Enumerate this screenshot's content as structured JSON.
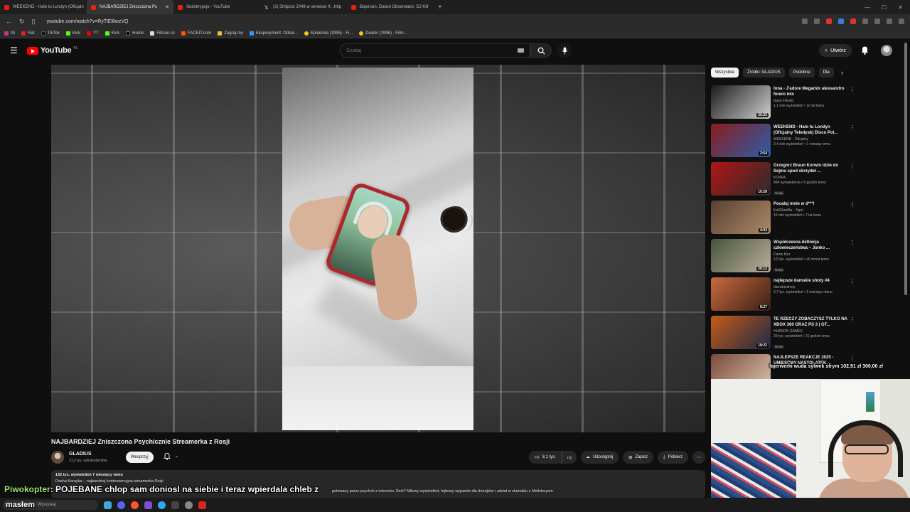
{
  "browser": {
    "tabs": [
      {
        "label": "WEEKEND - Halo tu Londyn (Oficjaln",
        "active": false,
        "icon": "youtube-icon"
      },
      {
        "label": "NAJBARDZIEJ Zniszczona Ps",
        "active": true,
        "icon": "youtube-icon"
      },
      {
        "label": "Subskrypcje - YouTube",
        "active": false,
        "icon": "youtube-icon"
      },
      {
        "label": "(3) Shitpost 2049 w serwisie X: „http",
        "active": false,
        "icon": "x-icon"
      },
      {
        "label": "Bajorson, Dawid Obserwator, DJ Kill",
        "active": false,
        "icon": "youtube-icon"
      }
    ],
    "url": "youtube.com/watch?v=RyTlEl8wzVQ",
    "bookmarks": [
      "IG",
      "Rat",
      "TikTok",
      "Kick",
      "YT",
      "Kick",
      "Home",
      "Filman.cc",
      "FACEIT.com",
      "Zagraj.my",
      "Eksperyment: Odsia...",
      "Epidemia (1995) - Fi...",
      "Dealer (1996) - Film..."
    ]
  },
  "header": {
    "logo_text": "YouTube",
    "logo_country": "PL",
    "search_placeholder": "Szukaj",
    "create_label": "Utwórz"
  },
  "video": {
    "title": "NAJBARDZIEJ Zniszczona Psychicznie Streamerka z Rosji",
    "channel_name": "GLADIUS",
    "channel_subs": "31,2 tys. subskrybentów",
    "support_label": "Wesprzyj",
    "likes": "3,1 tys.",
    "share_label": "Udostępnij",
    "save_label": "Zapisz",
    "download_label": "Pobierz",
    "desc_meta": "132 tys. wyświetleń  7 miesięcy temu",
    "desc_line1": "Dasha Karayka – najbardziej kontrowersyjna streamerka Rosji",
    "desc_line2": "pulowany przez psycholi z internetu. Dziś? Miliony wyświetleń, fejkowy wypadek dla donejtów i udział w skandalu z Mellstroyem."
  },
  "chips": [
    "Wszystkie",
    "Źródło: GLADIUS",
    "Podobne",
    "Dla"
  ],
  "recommendations": [
    {
      "title": "Inna - J'adore Megamix alessandro ferero mix",
      "channel": "Saša Frković",
      "stats": "1,1 mln wyświetleń • 10 lat temu",
      "badge": "",
      "duration": "20:25",
      "colors": [
        "#1b1b1b",
        "#cfcfcf"
      ]
    },
    {
      "title": "WEEKEND - Halo tu Londyn (Oficjalny Teledysk) Disco Pol...",
      "channel": "WEEKEND - Oficjalny",
      "stats": "2,4 mln wyświetleń • 1 miesiąc temu",
      "badge": "",
      "duration": "2:54",
      "colors": [
        "#8a1d1d",
        "#2a5da8"
      ]
    },
    {
      "title": "Grzegorz Braun Korwin idzie do Sejmu spod skrzydeł ...",
      "channel": "KONFA",
      "stats": "484 wyświetlenia • 5 godzin temu",
      "badge": "Nowy",
      "duration": "10:28",
      "colors": [
        "#b11616",
        "#2b2b2b"
      ]
    },
    {
      "title": "Pocałuj mnie w d***!",
      "channel": "KaRRamBa - Topic",
      "stats": "10 mln wyświetleń • 7 lat temu",
      "badge": "",
      "duration": "4:03",
      "colors": [
        "#5a4030",
        "#aa8a6a"
      ]
    },
    {
      "title": "Współczesna definicja człowieczeństwa – Junko ...",
      "channel": "Dama Kier",
      "stats": "1,5 tys. wyświetleń • 40 minut temu",
      "badge": "Nowy",
      "duration": "26:12",
      "colors": [
        "#44553a",
        "#bcae9a"
      ]
    },
    {
      "title": "najlepsze damskie shoty #4",
      "channel": "damskieshoty",
      "stats": "2,7 tys. wyświetleń • 2 miesiące temu",
      "badge": "",
      "duration": "8:27",
      "colors": [
        "#c86a3c",
        "#3a1f18"
      ]
    },
    {
      "title": "TE RZECZY ZOBACZYSZ TYLKO NA XBOX 360 ORAZ PS 3 | GT...",
      "channel": "HUBSON GAMES",
      "stats": "20 tys. wyświetleń • 21 godzin temu",
      "badge": "Nowy",
      "duration": "18:22",
      "colors": [
        "#c75b18",
        "#1c2a44"
      ]
    },
    {
      "title": "NAJLEPSZE REAKCJE 2025 - UMIEŚĆMY NASTOLATEK ...",
      "channel": "",
      "stats": "",
      "badge": "",
      "duration": "17:23",
      "colors": [
        "#7a4a3a",
        "#d7c0a8"
      ]
    }
  ],
  "overlay": {
    "chat_user": "Piwokopter",
    "chat_sep": ":",
    "chat_message": "POJEBANE chlop sam doniosl na siebie i teraz wpierdala chleb z",
    "donation": "fajerwerki wuda sylwek strym 102,91 zł  300,00 zł",
    "taskbar_search_big": "masłem",
    "taskbar_search_label": "Wyszukaj"
  },
  "colors": {
    "accent": "#ff0000",
    "bg": "#0f0f0f",
    "chip": "#272727"
  }
}
